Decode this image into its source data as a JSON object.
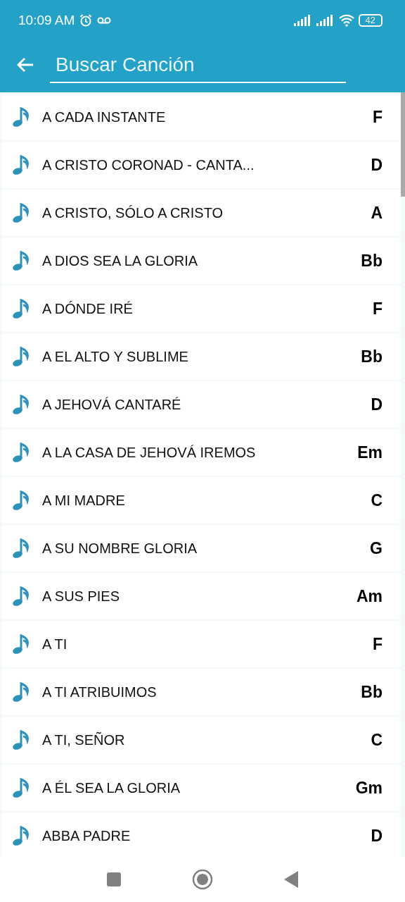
{
  "status_bar": {
    "time": "10:09 AM",
    "battery": "42"
  },
  "search": {
    "placeholder": "Buscar Canción"
  },
  "songs": [
    {
      "title": "A CADA INSTANTE",
      "key": "F"
    },
    {
      "title": "A CRISTO CORONAD - CANTA...",
      "key": "D"
    },
    {
      "title": "A CRISTO, SÓLO A CRISTO",
      "key": "A"
    },
    {
      "title": "A DIOS SEA LA GLORIA",
      "key": "Bb"
    },
    {
      "title": "A DÓNDE IRÉ",
      "key": "F"
    },
    {
      "title": "A EL ALTO Y SUBLIME",
      "key": "Bb"
    },
    {
      "title": "A JEHOVÁ CANTARÉ",
      "key": "D"
    },
    {
      "title": "A LA CASA DE JEHOVÁ IREMOS",
      "key": "Em"
    },
    {
      "title": "A MI MADRE",
      "key": "C"
    },
    {
      "title": "A SU NOMBRE GLORIA",
      "key": "G"
    },
    {
      "title": "A SUS PIES",
      "key": "Am"
    },
    {
      "title": "A TI",
      "key": "F"
    },
    {
      "title": "A TI ATRIBUIMOS",
      "key": "Bb"
    },
    {
      "title": "A TI, SEÑOR",
      "key": "C"
    },
    {
      "title": "A ÉL SEA LA GLORIA",
      "key": "Gm"
    },
    {
      "title": "ABBA PADRE",
      "key": "D"
    }
  ]
}
